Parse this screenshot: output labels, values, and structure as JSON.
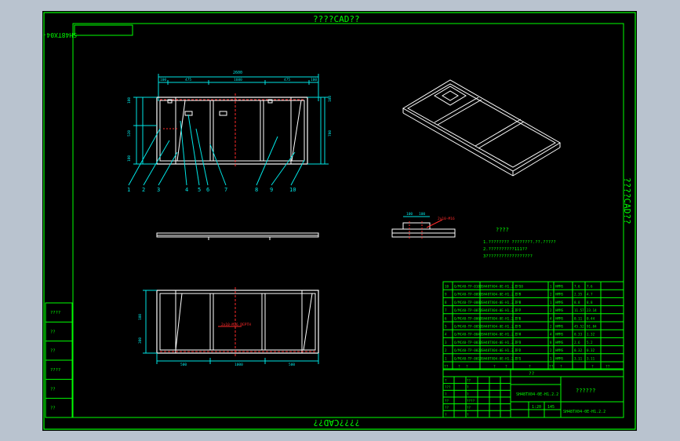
{
  "watermark": {
    "top": "????CAD??",
    "right": "????CAD??",
    "bottom": "????CAD??",
    "mirrored_code": "SH48TX04-0E-H1.2.2"
  },
  "colors": {
    "background": "#000000",
    "frame": "#00ff00",
    "outline": "#ffffff",
    "dimension": "#00e5e5",
    "hidden": "#ff2a2a",
    "surround": "#b9c3cf"
  },
  "top_view": {
    "overall_dim": "2600",
    "segment_dims": [
      "100",
      "475",
      "1600",
      "475",
      "100"
    ],
    "left_dims": [
      "100",
      "520",
      "100"
    ],
    "right_dims": [
      "100",
      "700"
    ],
    "leaders": [
      "1",
      "2",
      "3",
      "4",
      "5",
      "6",
      "7",
      "8",
      "9",
      "10"
    ]
  },
  "bottom_view": {
    "bottom_dims": [
      "500",
      "1000",
      "500"
    ],
    "left_dims": [
      "100",
      "300"
    ],
    "annotation": "2x10-M16 DEPTH"
  },
  "detail": {
    "dims": [
      "100",
      "100"
    ],
    "callout": "2x10-M16"
  },
  "notes": {
    "title": "????",
    "lines": [
      "1.???????? ????????.??.?????",
      "2.??????????111??",
      "3??????????????????"
    ]
  },
  "parts_table": {
    "rows": [
      {
        "no": "10",
        "code": "Q/MC40-TP-0100",
        "name": "SH48TX04-0E-H1.2.2-10",
        "note": "???",
        "qty": "1",
        "mat": "HMMS",
        "unit": "7.6",
        "total": "7.6"
      },
      {
        "no": "9",
        "code": "Q/MC40-TP-0090",
        "name": "SH48TX04-0E-H1.2.2-9",
        "note": "???",
        "qty": "2",
        "mat": "HMMS",
        "unit": "2.35",
        "total": "4.7"
      },
      {
        "no": "8",
        "code": "Q/MC40-TP-0080",
        "name": "SH48TX04-0E-H1.2.2-8",
        "note": "???",
        "qty": "1",
        "mat": "HMMS",
        "unit": "8.8",
        "total": "8.8"
      },
      {
        "no": "7",
        "code": "Q/MC40-TP-0070",
        "name": "SH48TX04-0E-H1.2.2-7",
        "note": "???",
        "qty": "2",
        "mat": "HMMS",
        "unit": "11.57",
        "total": "23.14"
      },
      {
        "no": "6",
        "code": "Q/MC40-TP-0060",
        "name": "SH48TX04-0E-H1.2.2-6",
        "note": "???",
        "qty": "4",
        "mat": "HMMS",
        "unit": "0.11",
        "total": "0.44"
      },
      {
        "no": "5",
        "code": "Q/MC40-TP-0050",
        "name": "SH48TX04-0E-H1.2.2-5",
        "note": "???",
        "qty": "2",
        "mat": "HMMS",
        "unit": "45.52",
        "total": "91.04"
      },
      {
        "no": "4",
        "code": "Q/MC40-TP-0040",
        "name": "SH48TX04-0E-H1.2.2-4",
        "note": "???",
        "qty": "4",
        "mat": "HMMS",
        "unit": "0.33",
        "total": "1.32"
      },
      {
        "no": "3",
        "code": "Q/MC40-TP-0030",
        "name": "SH48TX04-0E-H1.2.2-3",
        "note": "???",
        "qty": "8",
        "mat": "HMMS",
        "unit": "2.6",
        "total": "5.2"
      },
      {
        "no": "2",
        "code": "Q/MC40-TP-0020",
        "name": "SH48TX04-0E-H1.2.2-2",
        "note": "???",
        "qty": "2",
        "mat": "HMMS",
        "unit": "0.32",
        "total": "0.32"
      },
      {
        "no": "1",
        "code": "Q/MC40-TP-0010",
        "name": "SH48TX04-0E-H1.2.2-1",
        "note": "???",
        "qty": "1",
        "mat": "HMMS",
        "unit": "3.11",
        "total": "3.11"
      }
    ],
    "header": [
      "??",
      "?",
      "?",
      "?",
      "?",
      "?",
      "??",
      "?",
      "?",
      "??"
    ]
  },
  "title_block": {
    "top_label": "??",
    "drawing_code": "SH48TX04-0E-H1.2.2",
    "drawing_name": "??????",
    "scale": "1:20",
    "weight": "145",
    "code_repeat": "SH48TX04-0E-H1.2.2",
    "cells": [
      "?",
      "??",
      "???",
      "?",
      "?",
      "?",
      "??",
      "????",
      "??",
      "??",
      "?",
      "?"
    ]
  },
  "left_strip": [
    "????",
    "??",
    "??",
    "????",
    "??",
    "??"
  ]
}
